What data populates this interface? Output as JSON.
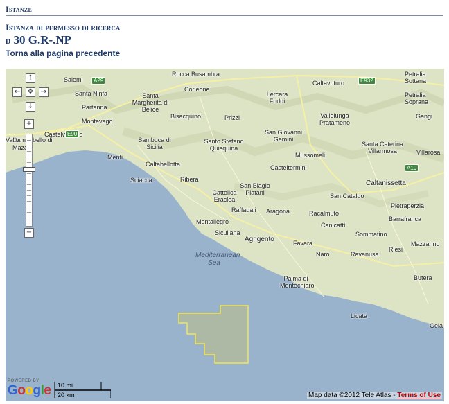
{
  "header": {
    "section_title": "Istanze",
    "subtitle": "Istanza di permesso di ricerca",
    "code_prefix": "d",
    "code_value": "30 G.R-.NP",
    "back_link": "Torna alla pagina precedente"
  },
  "map": {
    "colors": {
      "sea": "#99b3cc",
      "land": "#dde4c6",
      "permit_outline": "#f2e74d",
      "permit_fill": "#b4bb98",
      "road": "#f6f0a4",
      "motorway_shield": "#3d8a3d",
      "terms_link": "#c00000"
    },
    "controls": {
      "pan_up": "↑",
      "pan_left": "←",
      "pan_center": "✥",
      "pan_right": "→",
      "pan_down": "↓",
      "zoom_in": "+",
      "zoom_out": "−"
    },
    "places": [
      "Salemi",
      "Rocca Busambra",
      "Caltavuturo",
      "Petralia Sottana",
      "Santa Ninfa",
      "Corleone",
      "Lercara Friddi",
      "Petralia Soprana",
      "Partanna",
      "Santa Margherita di Belice",
      "Bisacquino",
      "Prizzi",
      "Vallelunga Pratameno",
      "Gangi",
      "Montevago",
      "Castelvetrano",
      "Campobello di Mazara",
      "Sambuca di Sicilia",
      "Santo Stefano Quisquina",
      "San Giovanni Gemini",
      "Santa Caterina Villarmosa",
      "Villarosa",
      "Vallo",
      "Menfi",
      "Caltabellotta",
      "Mussomeli",
      "Casteltermini",
      "Sciacca",
      "Ribera",
      "Caltanissetta",
      "San Biagio Platani",
      "Cattolica Eraclea",
      "Raffadali",
      "Aragona",
      "San Cataldo",
      "Pietraperzia",
      "Montallegro",
      "Racalmuto",
      "Canicattì",
      "Barrafranca",
      "Siculiana",
      "Agrigento",
      "Favara",
      "Sommatino",
      "Naro",
      "Riesi",
      "Ravanusa",
      "Mazzarino",
      "Palma di Montechiaro",
      "Butera",
      "Licata",
      "Gela"
    ],
    "sea_label": "Mediterranean Sea",
    "roads": [
      "A29",
      "E932",
      "E90",
      "A19"
    ],
    "powered_by": "POWERED BY",
    "logo_text": "Google",
    "scale_mi": "10 mi",
    "scale_km": "20 km",
    "attribution": "Map data ©2012 Tele Atlas - ",
    "terms_link": "Terms of Use"
  }
}
